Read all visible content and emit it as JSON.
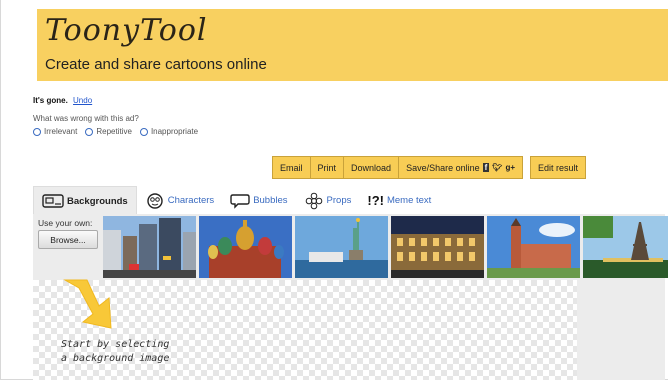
{
  "header": {
    "logo": "ToonyTool",
    "tagline": "Create and share cartoons online"
  },
  "ad": {
    "gone": "It's gone.",
    "undo": "Undo",
    "question": "What was wrong with this ad?",
    "options": [
      "Irrelevant",
      "Repetitive",
      "Inappropriate"
    ]
  },
  "actions": {
    "email": "Email",
    "print": "Print",
    "download": "Download",
    "save_share": "Save/Share online",
    "edit": "Edit result"
  },
  "tabs": [
    {
      "label": "Backgrounds",
      "icon": "picture-icon"
    },
    {
      "label": "Characters",
      "icon": "face-icon"
    },
    {
      "label": "Bubbles",
      "icon": "speech-bubble-icon"
    },
    {
      "label": "Props",
      "icon": "flower-icon"
    },
    {
      "label": "Meme text",
      "icon": "exclaim-icon"
    }
  ],
  "panel": {
    "use_own": "Use your own:",
    "browse": "Browse...",
    "hint_line1": "Start by selecting",
    "hint_line2": "a background image"
  },
  "colors": {
    "header_bg": "#f8d060",
    "button_bg": "#f8cd55",
    "link": "#3a6bc0"
  },
  "thumbnails": [
    "city-street",
    "moscow-cathedral",
    "statue-of-liberty",
    "colosseum",
    "town-hall",
    "eiffel-tower"
  ]
}
